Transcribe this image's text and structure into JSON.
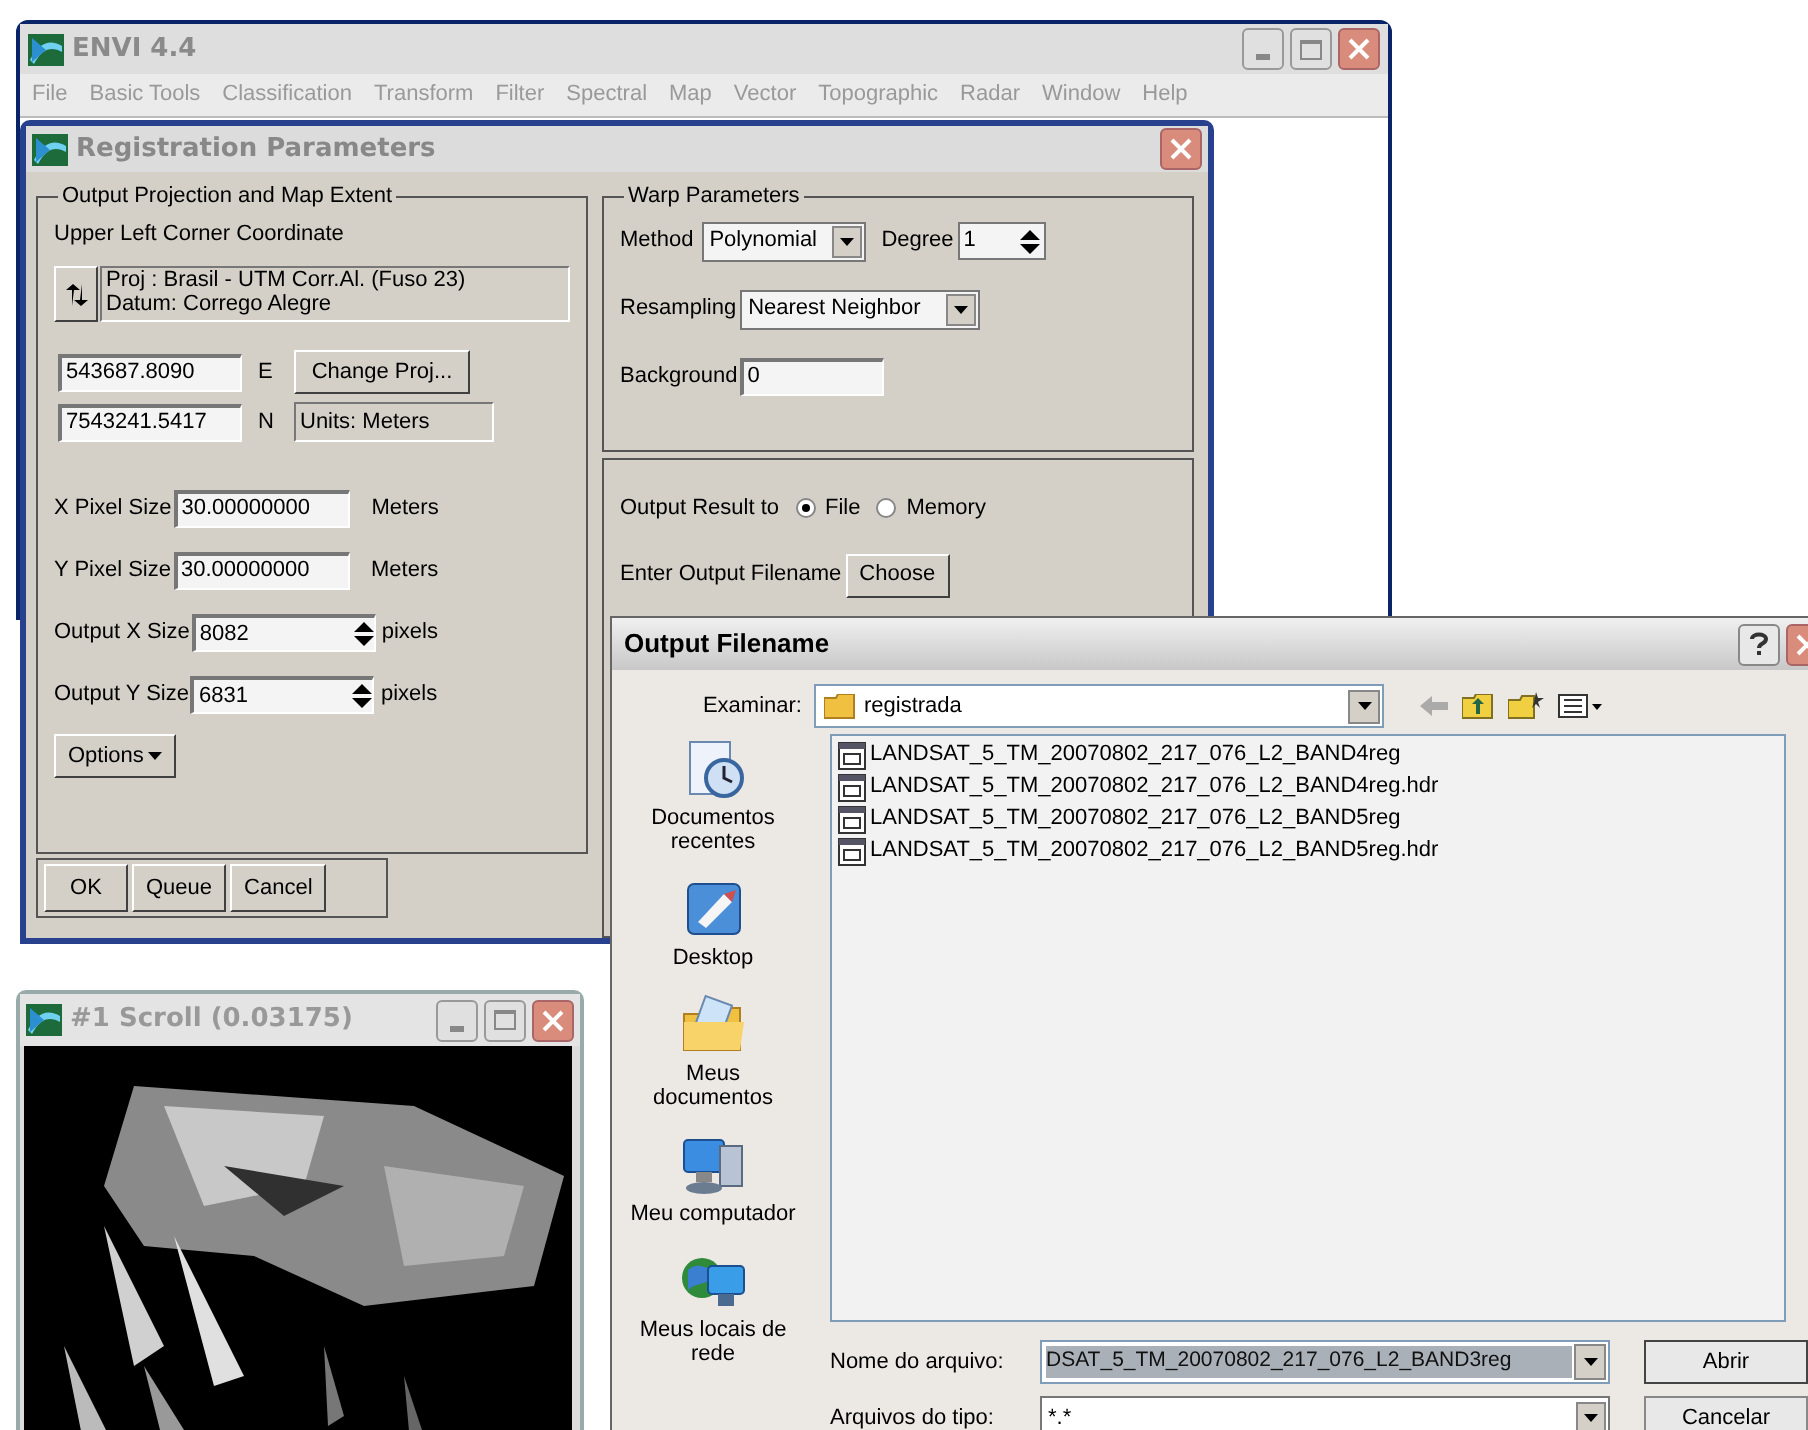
{
  "main_window": {
    "title": "ENVI 4.4",
    "menu": [
      "File",
      "Basic Tools",
      "Classification",
      "Transform",
      "Filter",
      "Spectral",
      "Map",
      "Vector",
      "Topographic",
      "Radar",
      "Window",
      "Help"
    ]
  },
  "registration": {
    "title": "Registration Parameters",
    "projection_group": {
      "title": "Output Projection and Map Extent",
      "corner_label": "Upper Left Corner Coordinate",
      "projection": "Proj : Brasil - UTM Corr.Al. (Fuso 23)",
      "datum": "Datum: Corrego Alegre",
      "easting": "543687.8090",
      "e_label": "E",
      "change_proj": "Change Proj...",
      "northing": "7543241.5417",
      "n_label": "N",
      "units": "Units: Meters",
      "sizes": [
        {
          "label": "X Pixel Size",
          "value": "30.00000000",
          "unit": "Meters",
          "kind": "text"
        },
        {
          "label": "Y Pixel Size",
          "value": "30.00000000",
          "unit": "Meters",
          "kind": "text"
        },
        {
          "label": "Output X Size",
          "value": "8082",
          "unit": "pixels",
          "kind": "spinner"
        },
        {
          "label": "Output Y Size",
          "value": "6831",
          "unit": "pixels",
          "kind": "spinner"
        }
      ],
      "options": "Options"
    },
    "buttons": [
      "OK",
      "Queue",
      "Cancel"
    ],
    "warp": {
      "title": "Warp Parameters",
      "method_label": "Method",
      "method": "Polynomial",
      "degree_label": "Degree",
      "degree": "1",
      "resampling_label": "Resampling",
      "resampling": "Nearest Neighbor",
      "background_label": "Background",
      "background": "0"
    },
    "output": {
      "label": "Output Result to",
      "options": [
        {
          "label": "File",
          "selected": true
        },
        {
          "label": "Memory",
          "selected": false
        }
      ],
      "filename_label": "Enter Output Filename",
      "choose": "Choose"
    }
  },
  "scroll_window": {
    "title": "#1 Scroll (0.03175)"
  },
  "file_dialog": {
    "title": "Output Filename",
    "look_in_label": "Examinar:",
    "folder": "registrada",
    "places": [
      {
        "label": "Documentos recentes",
        "kind": "recent"
      },
      {
        "label": "Desktop",
        "kind": "desktop"
      },
      {
        "label": "Meus documentos",
        "kind": "documents"
      },
      {
        "label": "Meu computador",
        "kind": "computer"
      },
      {
        "label": "Meus locais de rede",
        "kind": "network"
      }
    ],
    "files": [
      "LANDSAT_5_TM_20070802_217_076_L2_BAND4reg",
      "LANDSAT_5_TM_20070802_217_076_L2_BAND4reg.hdr",
      "LANDSAT_5_TM_20070802_217_076_L2_BAND5reg",
      "LANDSAT_5_TM_20070802_217_076_L2_BAND5reg.hdr"
    ],
    "filename_label": "Nome do arquivo:",
    "filename": "DSAT_5_TM_20070802_217_076_L2_BAND3reg",
    "type_label": "Arquivos do tipo:",
    "type": "*.*",
    "buttons": [
      "Abrir",
      "Cancelar"
    ]
  }
}
